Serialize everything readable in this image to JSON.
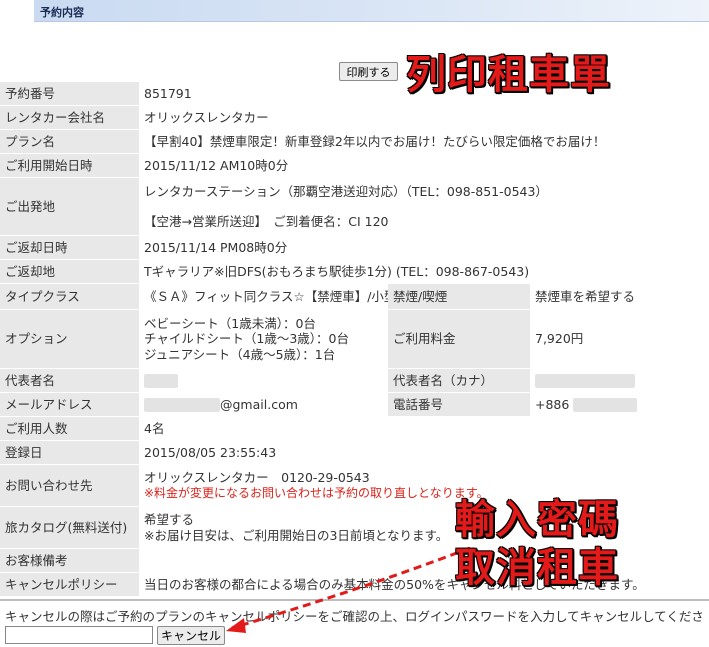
{
  "header": {
    "title": "予約内容"
  },
  "print_button": "印刷する",
  "annotations": {
    "print": "列印租車單",
    "password": "輸入密碼",
    "cancel": "取消租車"
  },
  "rows": {
    "reservation_number": {
      "label": "予約番号",
      "value": "851791"
    },
    "company": {
      "label": "レンタカー会社名",
      "value": "オリックスレンタカー"
    },
    "plan": {
      "label": "プラン名",
      "value": "【早割40】禁煙車限定！新車登録2年以内でお届け！たびらい限定価格でお届け！"
    },
    "start": {
      "label": "ご利用開始日時",
      "value": "2015/11/12 AM10時0分"
    },
    "departure": {
      "label": "ご出発地",
      "line1": "レンタカーステーション（那覇空港送迎対応）（TEL：098-851-0543）",
      "line2": "【空港→営業所送迎】　ご到着便名：CI 120"
    },
    "return_date": {
      "label": "ご返却日時",
      "value": "2015/11/14 PM08時0分"
    },
    "return_place": {
      "label": "ご返却地",
      "value": "Tギャラリア※旧DFS(おもろまち駅徒歩1分) (TEL：098-867-0543)"
    },
    "type_class": {
      "label": "タイプクラス",
      "value": "《ＳＡ》フィット同クラス☆【禁煙車】/小型",
      "label2": "禁煙/喫煙",
      "value2": "禁煙車を希望する"
    },
    "options": {
      "label": "オプション",
      "lines": [
        "ベビーシート（1歳未満）：0台",
        "チャイルドシート（1歳〜3歳）：0台",
        "ジュニアシート（4歳〜5歳）：1台"
      ],
      "label2": "ご利用料金",
      "value2": "7,920円"
    },
    "representative": {
      "label": "代表者名",
      "label2": "代表者名（カナ）"
    },
    "email": {
      "label": "メールアドレス",
      "value": "@gmail.com",
      "label2": "電話番号",
      "value2": "+886"
    },
    "people": {
      "label": "ご利用人数",
      "value": "4名"
    },
    "registered": {
      "label": "登録日",
      "value": "2015/08/05 23:55:43"
    },
    "contact": {
      "label": "お問い合わせ先",
      "line1": "オリックスレンタカー　0120-29-0543",
      "line2": "※料金が変更になるお問い合わせは予約の取り直しとなります。"
    },
    "catalog": {
      "label": "旅カタログ(無料送付)",
      "line1": "希望する",
      "line2": "※お届け目安は、ご利用開始日の3日前頃となります。"
    },
    "remarks": {
      "label": "お客様備考"
    },
    "cancel_policy": {
      "label": "キャンセルポリシー",
      "value": "当日のお客様の都合による場合のみ基本料金の50%をキャンセル料としていただきます。"
    }
  },
  "cancel_section": {
    "note": "キャンセルの際はご予約のプランのキャンセルポリシーをご確認の上、ログインパスワードを入力してキャンセルしてください。",
    "button": "キャンセル"
  }
}
